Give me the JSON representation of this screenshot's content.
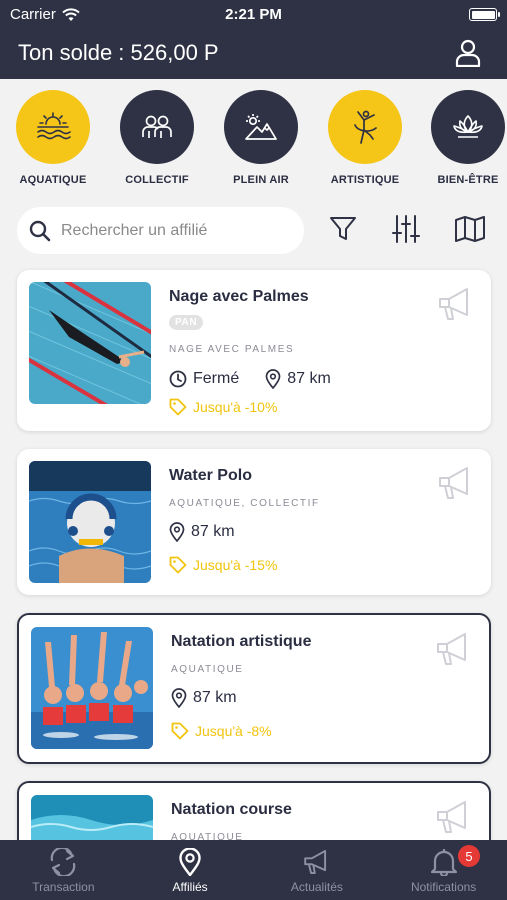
{
  "status": {
    "carrier": "Carrier",
    "time": "2:21 PM"
  },
  "header": {
    "balance": "Ton solde : 526,00 P"
  },
  "categories": [
    {
      "label": "AQUATIQUE",
      "color": "#f5c518",
      "icon": "sun-waves-icon"
    },
    {
      "label": "COLLECTIF",
      "color": "#2f3244",
      "icon": "people-group-icon"
    },
    {
      "label": "PLEIN AIR",
      "color": "#2f3244",
      "icon": "mountain-sun-icon"
    },
    {
      "label": "ARTISTIQUE",
      "color": "#f5c518",
      "icon": "dancer-icon"
    },
    {
      "label": "BIEN-ÊTRE",
      "color": "#2f3244",
      "icon": "lotus-icon"
    }
  ],
  "search": {
    "placeholder": "Rechercher un affilié"
  },
  "cards": [
    {
      "title": "Nage avec Palmes",
      "badge": "PAN",
      "category": "NAGE AVEC PALMES",
      "hours": "Fermé",
      "distance": "87 km",
      "promo": "Jusqu'à -10%"
    },
    {
      "title": "Water Polo",
      "category": "AQUATIQUE, COLLECTIF",
      "distance": "87 km",
      "promo": "Jusqu'à -15%"
    },
    {
      "title": "Natation artistique",
      "category": "AQUATIQUE",
      "distance": "87 km",
      "promo": "Jusqu'à -8%"
    },
    {
      "title": "Natation course",
      "category": "AQUATIQUE"
    }
  ],
  "tabs": [
    {
      "label": "Transaction",
      "icon": "transfer-arrows-icon"
    },
    {
      "label": "Affiliés",
      "icon": "map-pin-icon"
    },
    {
      "label": "Actualités",
      "icon": "megaphone-icon"
    },
    {
      "label": "Notifications",
      "icon": "bell-icon",
      "badge": "5"
    }
  ],
  "colors": {
    "navy": "#2f3244",
    "yellow": "#f5c518",
    "promo": "#f1c40f",
    "badge_red": "#e53935"
  }
}
